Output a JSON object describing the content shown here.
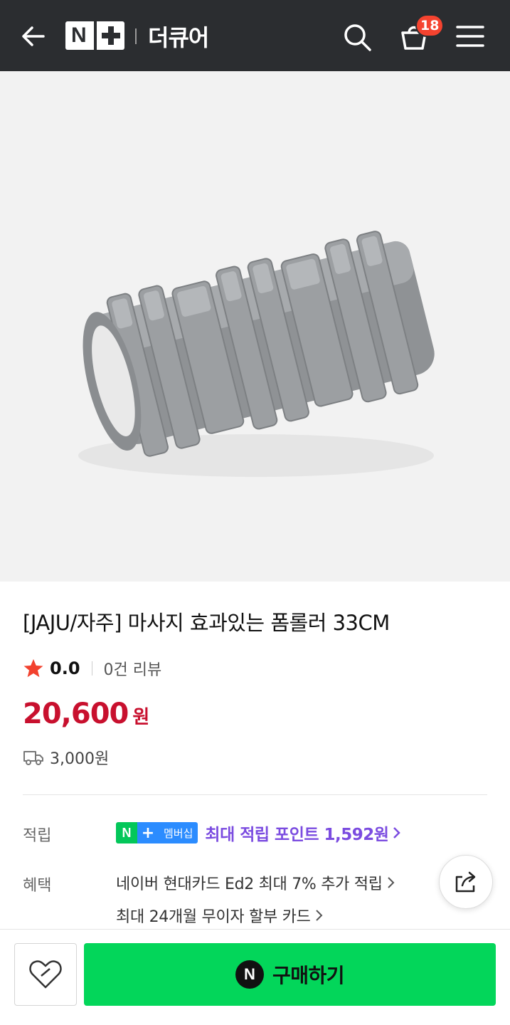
{
  "header": {
    "logo_text": "N",
    "store_name": "더큐어",
    "cart_count": "18",
    "colors": {
      "bar": "#2b2d30",
      "badge": "#f5432f"
    },
    "icons": [
      "back-arrow-icon",
      "search-icon",
      "cart-icon",
      "menu-icon"
    ]
  },
  "product": {
    "image_name": "gray foam roller",
    "title": "[JAJU/자주] 마사지 효과있는 폼롤러 33CM",
    "rating": "0.0",
    "review_count": "0건 리뷰",
    "price": "20,600",
    "price_unit": "원",
    "shipping_fee": "3,000원",
    "price_color": "#c8102e"
  },
  "benefits": {
    "points_label": "적립",
    "membership_badge_n": "N",
    "membership_badge_plus": "+",
    "membership_badge_text": "멤버십",
    "points_text": "최대 적립 포인트 1,592원",
    "benefit_label": "혜택",
    "card_offer": "네이버 현대카드 Ed2 최대 7% 추가 적립",
    "installment_offer": "최대 24개월 무이자 할부 카드"
  },
  "actions": {
    "buy_icon_text": "N",
    "buy_label": "구매하기",
    "buy_color": "#03d65a",
    "wishlist_icon": "heart-icon",
    "share_icon": "share-icon"
  }
}
